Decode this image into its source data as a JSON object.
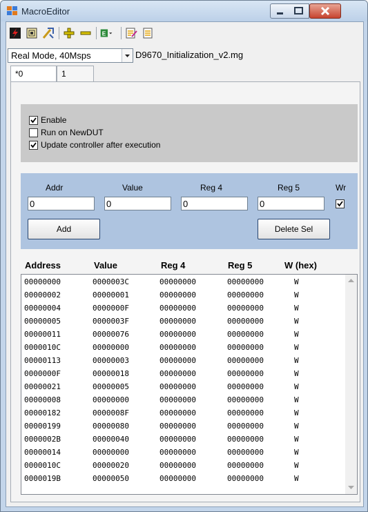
{
  "window": {
    "title": "MacroEditor"
  },
  "toolbar": {
    "icons": [
      "lightning-icon",
      "grid-icon",
      "wand-icon",
      "plus-icon",
      "minus-icon",
      "export-dropdown-icon",
      "edit-doc-icon",
      "doc-icon"
    ]
  },
  "mode": {
    "selected": "Real Mode, 40Msps"
  },
  "file": {
    "name": "D9670_Initialization_v2.mg"
  },
  "tabs": [
    {
      "label": "*0"
    },
    {
      "label": "1"
    }
  ],
  "options": {
    "enable": {
      "label": "Enable",
      "checked": true
    },
    "run_on_newdut": {
      "label": "Run on NewDUT",
      "checked": false
    },
    "update_controller": {
      "label": "Update controller after execution",
      "checked": true
    }
  },
  "registers": {
    "addr_label": "Addr",
    "value_label": "Value",
    "reg4_label": "Reg 4",
    "reg5_label": "Reg 5",
    "w_label": "Wr",
    "addr_value": "0",
    "value_value": "0",
    "reg4_value": "0",
    "reg5_value": "0",
    "w_checked": true,
    "add_label": "Add",
    "delete_label": "Delete Sel"
  },
  "list": {
    "headers": [
      "Address",
      "Value",
      "Reg 4",
      "Reg 5",
      "W (hex)"
    ],
    "rows": [
      [
        "00000000",
        "0000003C",
        "00000000",
        "00000000",
        "W"
      ],
      [
        "00000002",
        "00000001",
        "00000000",
        "00000000",
        "W"
      ],
      [
        "00000004",
        "0000000F",
        "00000000",
        "00000000",
        "W"
      ],
      [
        "00000005",
        "0000003F",
        "00000000",
        "00000000",
        "W"
      ],
      [
        "00000011",
        "00000076",
        "00000000",
        "00000000",
        "W"
      ],
      [
        "0000010C",
        "00000000",
        "00000000",
        "00000000",
        "W"
      ],
      [
        "00000113",
        "00000003",
        "00000000",
        "00000000",
        "W"
      ],
      [
        "0000000F",
        "00000018",
        "00000000",
        "00000000",
        "W"
      ],
      [
        "00000021",
        "00000005",
        "00000000",
        "00000000",
        "W"
      ],
      [
        "00000008",
        "00000000",
        "00000000",
        "00000000",
        "W"
      ],
      [
        "00000182",
        "0000008F",
        "00000000",
        "00000000",
        "W"
      ],
      [
        "00000199",
        "00000080",
        "00000000",
        "00000000",
        "W"
      ],
      [
        "0000002B",
        "00000040",
        "00000000",
        "00000000",
        "W"
      ],
      [
        "00000014",
        "00000000",
        "00000000",
        "00000000",
        "W"
      ],
      [
        "0000010C",
        "00000020",
        "00000000",
        "00000000",
        "W"
      ],
      [
        "0000019B",
        "00000050",
        "00000000",
        "00000000",
        "W"
      ]
    ]
  }
}
